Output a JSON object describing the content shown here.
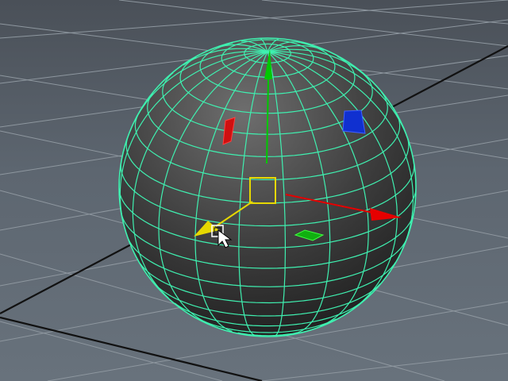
{
  "viewport": {
    "background_top": "#4a5058",
    "background_bottom": "#68727c",
    "grid_color": "#8e979f",
    "grid_axis_color": "#111111",
    "sphere_wire_color": "#3ff0b0",
    "sphere_fill_dark": "#1f1f1f",
    "sphere_fill_light": "#6a6a6a"
  },
  "manipulator": {
    "tool": "move-tool",
    "center_handle_color": "#e6d800",
    "x_axis_color": "#e60000",
    "y_axis_color": "#00c800",
    "z_axis_color": "#e6d800",
    "plane_xy_color": "#1030d0",
    "plane_xz_color": "#d01010",
    "plane_yz_color": "#10b010"
  },
  "cursor": {
    "icon": "arrow-cursor-icon"
  }
}
